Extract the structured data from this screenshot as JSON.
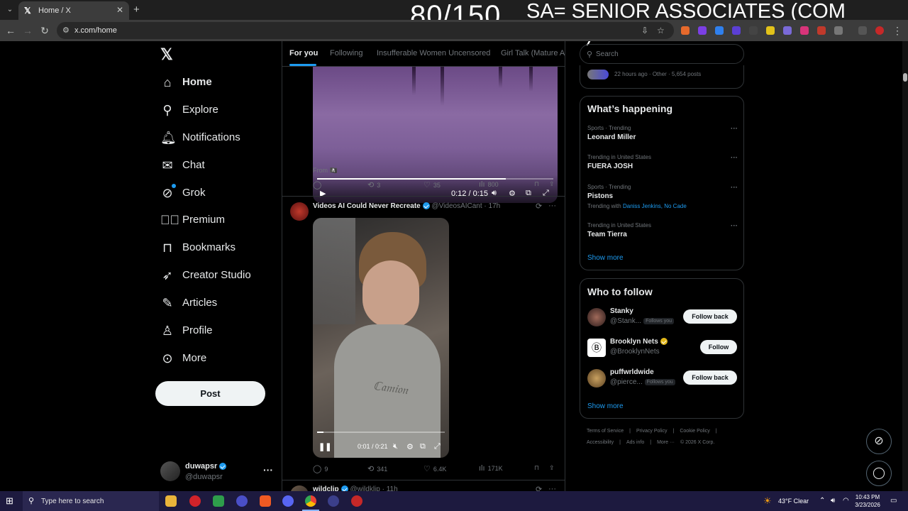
{
  "browser": {
    "tab_title": "Home / X",
    "url": "x.com/home",
    "overlay_counter": "80/150",
    "overlay_note": "SA= SENIOR ASSOCIATES (COM NAME)"
  },
  "nav": {
    "items": [
      {
        "label": "Home",
        "icon": "home-icon"
      },
      {
        "label": "Explore",
        "icon": "search-icon"
      },
      {
        "label": "Notifications",
        "icon": "bell-icon"
      },
      {
        "label": "Chat",
        "icon": "mail-icon"
      },
      {
        "label": "Grok",
        "icon": "grok-icon"
      },
      {
        "label": "Premium",
        "icon": "premium-icon"
      },
      {
        "label": "Bookmarks",
        "icon": "bookmark-icon"
      },
      {
        "label": "Creator Studio",
        "icon": "rocket-icon"
      },
      {
        "label": "Articles",
        "icon": "article-icon"
      },
      {
        "label": "Profile",
        "icon": "person-icon"
      },
      {
        "label": "More",
        "icon": "more-circle-icon"
      }
    ],
    "post_label": "Post",
    "account": {
      "name": "duwapsr",
      "handle": "@duwapsr"
    }
  },
  "feed": {
    "tabs": [
      "For you",
      "Following",
      "Insufferable Women Uncensored",
      "Girl Talk (Mature Ac"
    ],
    "post1": {
      "video_time": "0:12 / 0:15",
      "video_progress": 0.8,
      "from": "From 🏴‍☠️",
      "replies": "",
      "reposts": "3",
      "likes": "35",
      "views": "800"
    },
    "post2": {
      "author": "Videos AI Could Never Recreate",
      "handle": "@VideosAICant",
      "time": "· 17h",
      "video_time": "0:01 / 0:21",
      "video_progress": 0.05,
      "replies": "9",
      "reposts": "341",
      "likes": "6.4K",
      "views": "171K"
    },
    "post3": {
      "author": "wildclip",
      "handle": "@wildklip",
      "time": "· 11h"
    }
  },
  "sidebar": {
    "search_placeholder": "Search",
    "community_meta": "22 hours ago · Other · 5,654 posts",
    "happening_title": "What’s happening",
    "trends": [
      {
        "context": "Sports · Trending",
        "name": "Leonard Miller",
        "with": ""
      },
      {
        "context": "Trending in United States",
        "name": "FUERA JOSH",
        "with": ""
      },
      {
        "context": "Sports · Trending",
        "name": "Pistons",
        "with_label": "Trending with",
        "with": "Daniss Jenkins, No Cade"
      },
      {
        "context": "Trending in United States",
        "name": "Team Tierra",
        "with": ""
      }
    ],
    "show_more": "Show more",
    "who_to_follow_title": "Who to follow",
    "follow": [
      {
        "name": "Stanky",
        "handle": "@Stank...",
        "follows_you": "Follows you",
        "button": "Follow back"
      },
      {
        "name": "Brooklyn Nets",
        "handle": "@BrooklynNets",
        "follows_you": "",
        "button": "Follow"
      },
      {
        "name": "puffwrldwide",
        "handle": "@pierce...",
        "follows_you": "Follows you",
        "button": "Follow back"
      }
    ],
    "footer": [
      "Terms of Service",
      "|",
      "Privacy Policy",
      "|",
      "Cookie Policy",
      "|",
      "Accessibility",
      "|",
      "Ads info",
      "|",
      "More ···",
      "© 2026 X Corp."
    ]
  },
  "taskbar": {
    "search_placeholder": "Type here to search",
    "weather": "43°F  Clear",
    "time": "10:43 PM",
    "date": "3/23/2026"
  },
  "colors": {
    "accent": "#1d9bf0",
    "background": "#000000",
    "border": "#2f3336",
    "muted": "#71767b"
  }
}
